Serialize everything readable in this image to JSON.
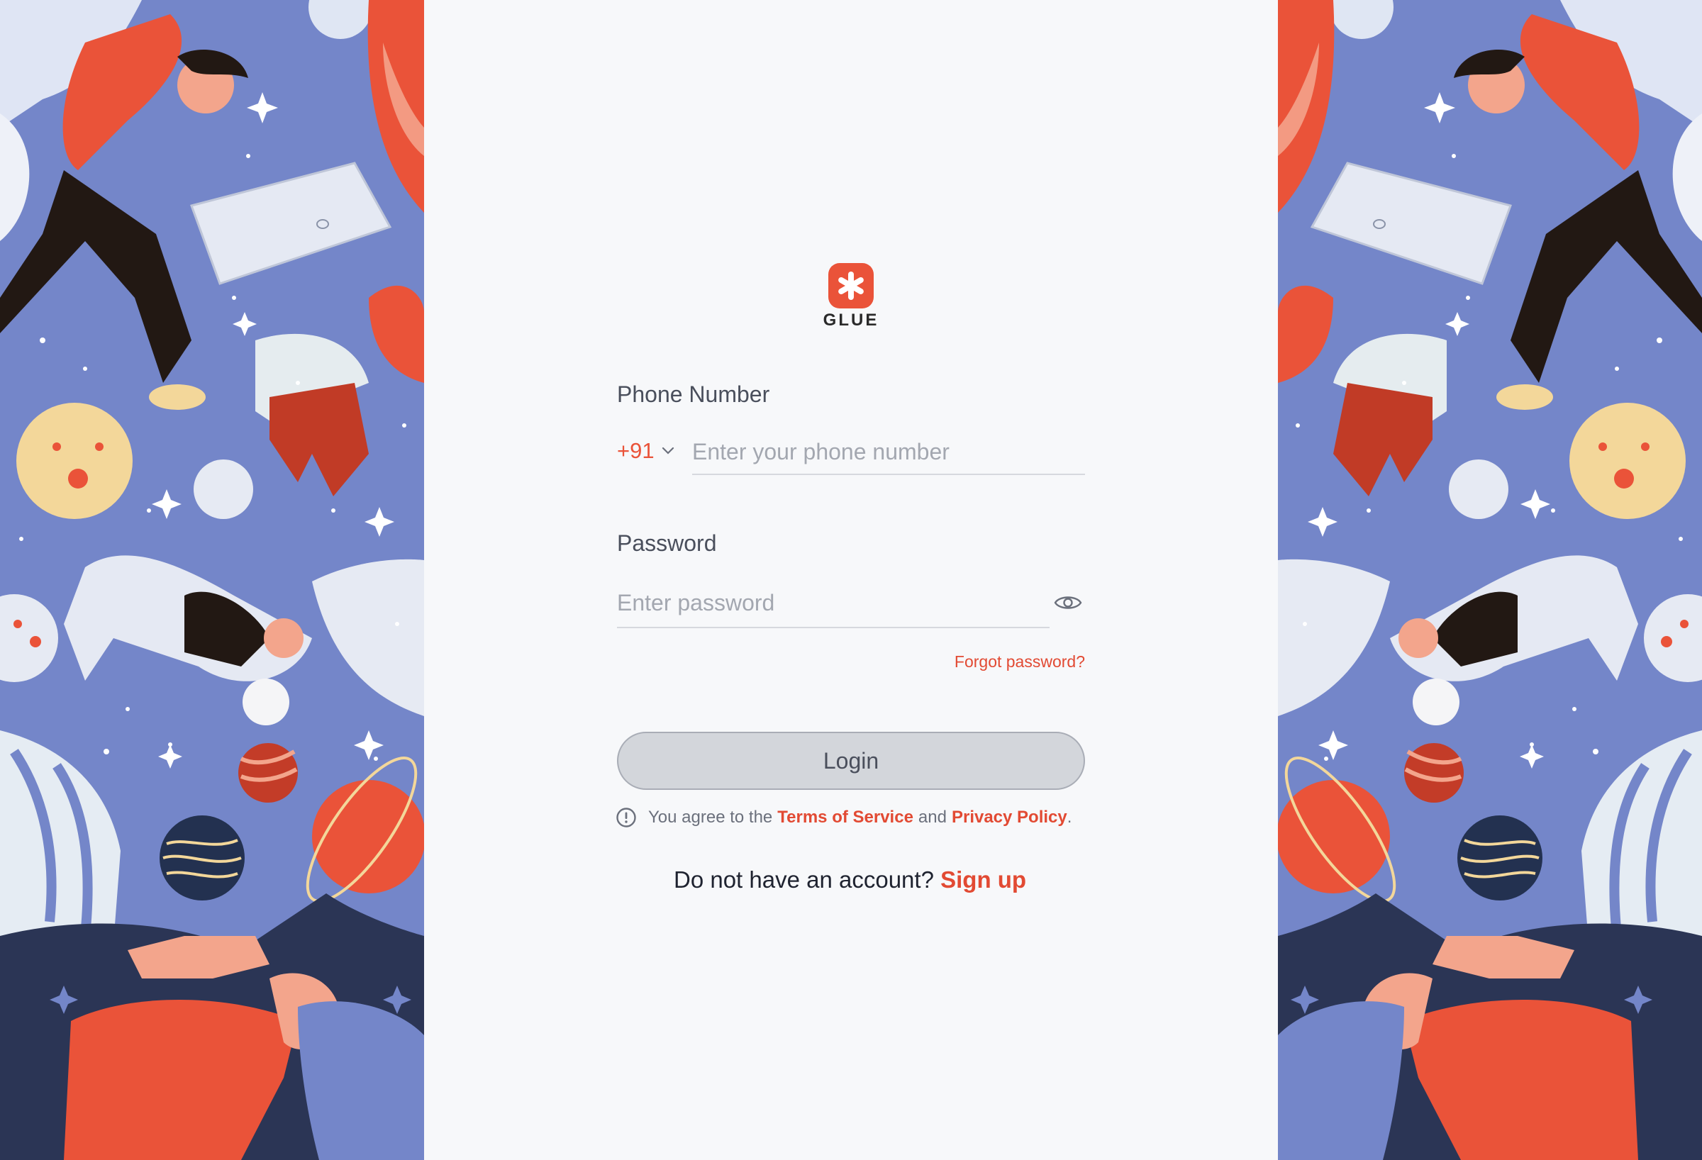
{
  "brand": {
    "name": "GLUE",
    "accent_color": "#ea5339"
  },
  "form": {
    "phone_label": "Phone Number",
    "country_code": "+91",
    "phone_placeholder": "Enter your phone number",
    "password_label": "Password",
    "password_placeholder": "Enter password",
    "forgot_password": "Forgot password?",
    "login_button": "Login"
  },
  "agreement": {
    "prefix": "You agree to the",
    "terms": "Terms of Service",
    "conjunction": "and",
    "privacy": "Privacy Policy",
    "suffix": "."
  },
  "signup": {
    "prompt": "Do not have an account?",
    "link": "Sign up"
  },
  "icons": {
    "logo": "asterisk-badge-icon",
    "country_chevron": "chevron-down-icon",
    "password_toggle": "eye-icon",
    "agreement_info": "info-circle-icon"
  },
  "colors": {
    "page_background": "#f7f8fa",
    "art_background": "#7486c9",
    "link": "#e24a33",
    "button_fill": "#d3d6db"
  }
}
